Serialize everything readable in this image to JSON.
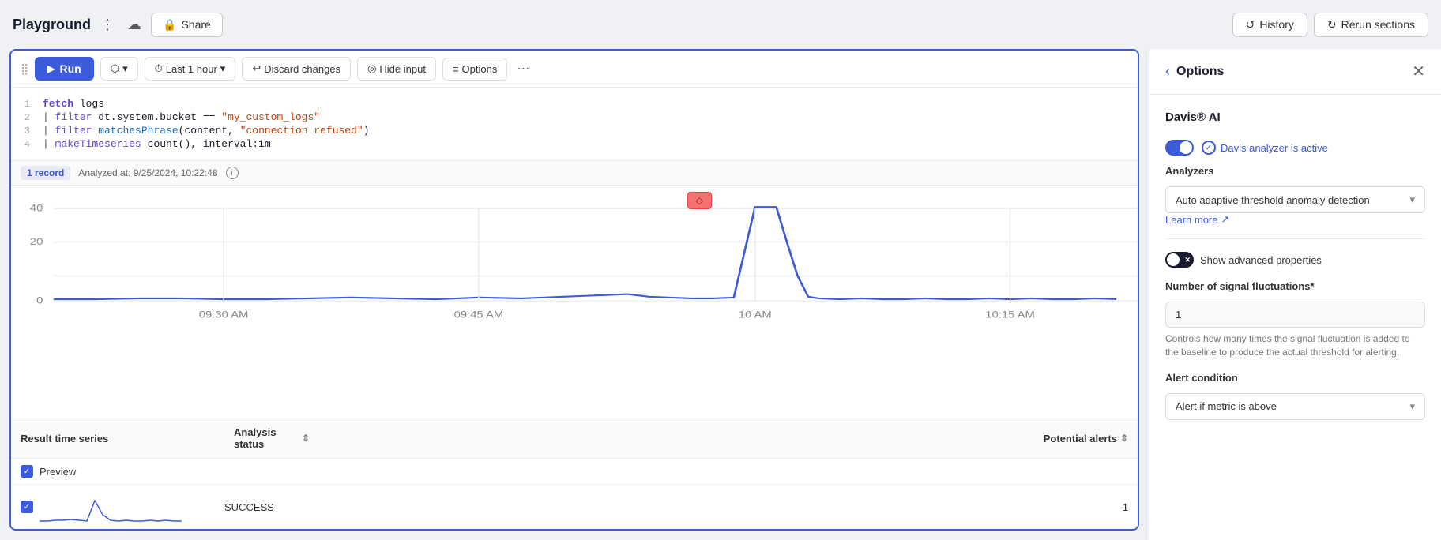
{
  "topbar": {
    "title": "Playground",
    "share_label": "Share",
    "history_label": "History",
    "rerun_label": "Rerun sections"
  },
  "toolbar": {
    "run_label": "Run",
    "time_range": "Last 1 hour",
    "discard_label": "Discard changes",
    "hide_input_label": "Hide input",
    "options_label": "Options"
  },
  "code_lines": [
    {
      "num": "1",
      "content": "fetch logs"
    },
    {
      "num": "2",
      "content": "| filter dt.system.bucket == \"my_custom_logs\""
    },
    {
      "num": "3",
      "content": "| filter matchesPhrase(content, \"connection refused\")"
    },
    {
      "num": "4",
      "content": "| makeTimeseries count(), interval:1m"
    }
  ],
  "status": {
    "record_count": "1 record",
    "analyzed_at": "Analyzed at: 9/25/2024, 10:22:48"
  },
  "chart": {
    "x_labels": [
      "09:30 AM",
      "09:45 AM",
      "10 AM",
      "10:15 AM"
    ],
    "y_labels": [
      "0",
      "20",
      "40"
    ],
    "alert_icon": "◇"
  },
  "table": {
    "col_series": "Result time series",
    "col_status": "Analysis status",
    "col_alerts": "Potential alerts",
    "preview_row": {
      "label": "Preview"
    },
    "data_row": {
      "status": "SUCCESS",
      "alerts": "1"
    }
  },
  "options": {
    "title": "Options",
    "back_icon": "‹",
    "close_icon": "✕",
    "section_davis": "Davis® AI",
    "davis_active_label": "Davis analyzer is active",
    "analyzers_label": "Analyzers",
    "analyzer_value": "Auto adaptive threshold anomaly detection",
    "learn_more_label": "Learn more",
    "show_advanced_label": "Show advanced properties",
    "signal_fluctuations_label": "Number of signal fluctuations*",
    "signal_fluctuations_value": "1",
    "signal_hint": "Controls how many times the signal fluctuation is added to the baseline to produce the actual threshold for alerting.",
    "alert_condition_label": "Alert condition",
    "alert_condition_value": "Alert if metric is above"
  }
}
